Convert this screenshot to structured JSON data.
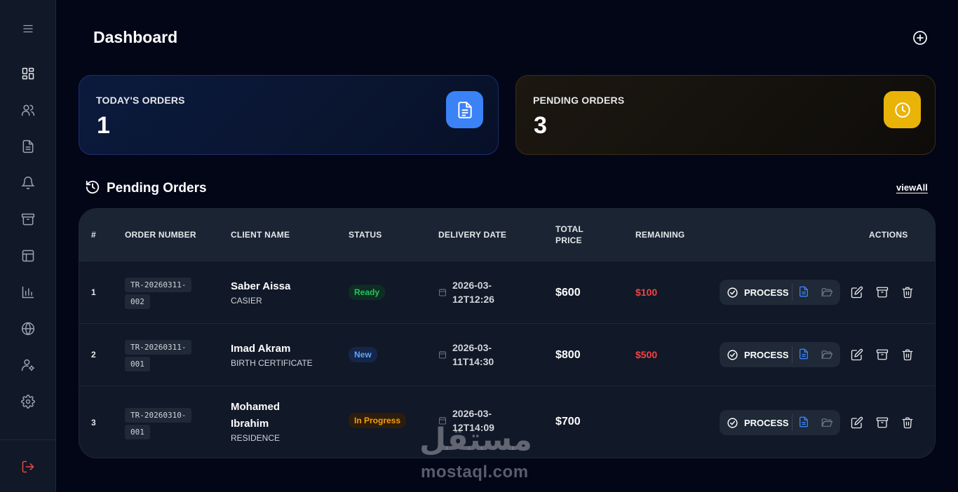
{
  "sidebar": {
    "items": [
      {
        "icon": "menu-icon"
      },
      {
        "icon": "dashboard-icon"
      },
      {
        "icon": "users-icon"
      },
      {
        "icon": "document-icon"
      },
      {
        "icon": "bell-icon"
      },
      {
        "icon": "archive-icon"
      },
      {
        "icon": "layout-icon"
      },
      {
        "icon": "bar-chart-icon"
      },
      {
        "icon": "globe-icon"
      },
      {
        "icon": "user-settings-icon"
      },
      {
        "icon": "settings-icon"
      },
      {
        "icon": "logout-icon"
      }
    ]
  },
  "header": {
    "title": "Dashboard"
  },
  "stats": {
    "today": {
      "label": "TODAY'S ORDERS",
      "value": "1",
      "color": "#3b82f6"
    },
    "pending": {
      "label": "PENDING ORDERS",
      "value": "3",
      "color": "#eab308"
    }
  },
  "section": {
    "title": "Pending Orders",
    "view_all": "viewAll"
  },
  "table": {
    "headers": {
      "index": "#",
      "order_number": "ORDER NUMBER",
      "client_name": "CLIENT NAME",
      "status": "STATUS",
      "delivery_date": "DELIVERY DATE",
      "total_price_1": "TOTAL",
      "total_price_2": "PRICE",
      "remaining": "REMAINING",
      "actions": "ACTIONS"
    },
    "rows": [
      {
        "index": "1",
        "order_1": "TR-20260311-",
        "order_2": "002",
        "name_1": "Saber Aissa",
        "name_2": "",
        "type": "CASIER",
        "status": "Ready",
        "date_1": "2026-03-",
        "date_2": "12T12:26",
        "price": "$600",
        "remaining": "$100",
        "process": "PROCESS"
      },
      {
        "index": "2",
        "order_1": "TR-20260311-",
        "order_2": "001",
        "name_1": "Imad Akram",
        "name_2": "",
        "type": "BIRTH CERTIFICATE",
        "status": "New",
        "date_1": "2026-03-",
        "date_2": "11T14:30",
        "price": "$800",
        "remaining": "$500",
        "process": "PROCESS"
      },
      {
        "index": "3",
        "order_1": "TR-20260310-",
        "order_2": "001",
        "name_1": "Mohamed",
        "name_2": "Ibrahim",
        "type": "RESIDENCE",
        "status": "In Progress",
        "date_1": "2026-03-",
        "date_2": "12T14:09",
        "price": "$700",
        "remaining": "",
        "process": "PROCESS"
      }
    ]
  },
  "watermark": {
    "arabic": "مستقل",
    "latin": "mostaql.com"
  }
}
